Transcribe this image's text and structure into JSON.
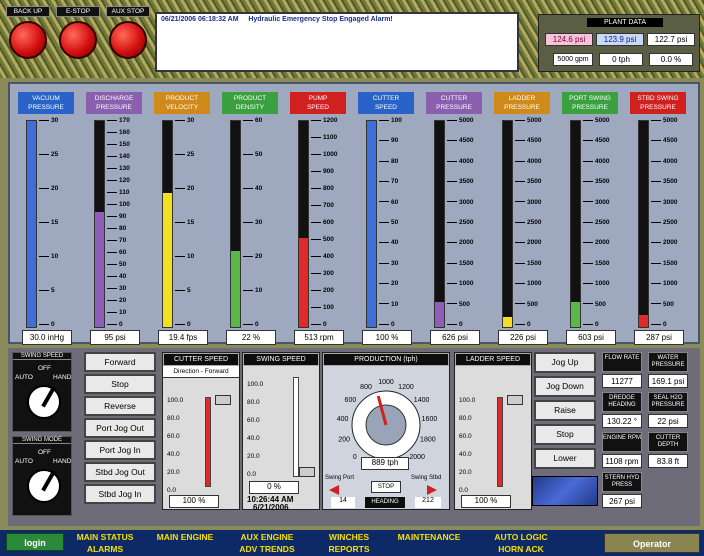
{
  "header": {
    "buttons": [
      "BACK UP",
      "E-STOP",
      "AUX STOP"
    ],
    "alarm_time": "06/21/2006 06:18:32 AM",
    "alarm_text": "Hydraulic Emergency Stop Engaged Alarm!",
    "plant": {
      "title": "PLANT DATA",
      "p1": "124.6 psi",
      "p2": "123.9 psi",
      "p3": "122.7 psi",
      "gpm": "5000 gpm",
      "tph": "0 tph",
      "pct": "0.0 %"
    }
  },
  "gauges": [
    {
      "t1": "VACUUM",
      "t2": "PRESSURE",
      "color": "#2a63c8",
      "fill": "#3e6fd6",
      "frac": 1.0,
      "value": "30.0 inHg",
      "ticks": [
        "30",
        "25",
        "20",
        "15",
        "10",
        "5",
        "0"
      ]
    },
    {
      "t1": "DISCHARGE",
      "t2": "PRESSURE",
      "color": "#8a5fb0",
      "fill": "#8e5fb8",
      "frac": 0.56,
      "value": "95 psi",
      "ticks": [
        "170",
        "160",
        "150",
        "140",
        "130",
        "120",
        "110",
        "100",
        "90",
        "80",
        "70",
        "60",
        "50",
        "40",
        "30",
        "20",
        "10",
        "0"
      ]
    },
    {
      "t1": "PRODUCT",
      "t2": "VELOCITY",
      "color": "#d08a1a",
      "fill": "#f0e020",
      "frac": 0.65,
      "value": "19.4 fps",
      "ticks": [
        "30",
        "25",
        "20",
        "15",
        "10",
        "5",
        "0"
      ]
    },
    {
      "t1": "PRODUCT",
      "t2": "DENSITY",
      "color": "#3aa040",
      "fill": "#5ab848",
      "frac": 0.37,
      "value": "22 %",
      "ticks": [
        "60",
        "50",
        "40",
        "30",
        "20",
        "10",
        "0"
      ]
    },
    {
      "t1": "PUMP",
      "t2": "SPEED",
      "color": "#d02020",
      "fill": "#e02a2a",
      "frac": 0.43,
      "value": "513 rpm",
      "ticks": [
        "1200",
        "1100",
        "1000",
        "900",
        "800",
        "700",
        "600",
        "500",
        "400",
        "300",
        "200",
        "100",
        "0"
      ]
    },
    {
      "t1": "CUTTER",
      "t2": "SPEED",
      "color": "#2a63c8",
      "fill": "#3e6fd6",
      "frac": 1.0,
      "value": "100 %",
      "ticks": [
        "100",
        "90",
        "80",
        "70",
        "60",
        "50",
        "40",
        "30",
        "20",
        "10",
        "0"
      ]
    },
    {
      "t1": "CUTTER",
      "t2": "PRESSURE",
      "color": "#8a5fb0",
      "fill": "#8e5fb8",
      "frac": 0.12,
      "value": "626 psi",
      "ticks": [
        "5000",
        "4500",
        "4000",
        "3500",
        "3000",
        "2500",
        "2000",
        "1500",
        "1000",
        "500",
        "0"
      ]
    },
    {
      "t1": "LADDER",
      "t2": "PRESSURE",
      "color": "#d08a1a",
      "fill": "#f0e020",
      "frac": 0.05,
      "value": "226 psi",
      "ticks": [
        "5000",
        "4500",
        "4000",
        "3500",
        "3000",
        "2500",
        "2000",
        "1500",
        "1000",
        "500",
        "0"
      ]
    },
    {
      "t1": "PORT SWING",
      "t2": "PRESSURE",
      "color": "#3aa040",
      "fill": "#5ab848",
      "frac": 0.12,
      "value": "603 psi",
      "ticks": [
        "5000",
        "4500",
        "4000",
        "3500",
        "3000",
        "2500",
        "2000",
        "1500",
        "1000",
        "500",
        "0"
      ]
    },
    {
      "t1": "STBD SWING",
      "t2": "PRESSURE",
      "color": "#d02020",
      "fill": "#e02a2a",
      "frac": 0.06,
      "value": "287 psi",
      "ticks": [
        "5000",
        "4500",
        "4000",
        "3500",
        "3000",
        "2500",
        "2000",
        "1500",
        "1000",
        "500",
        "0"
      ]
    }
  ],
  "controls": {
    "swing_speed": "SWING SPEED",
    "swing_mode": "SWING MODE",
    "off": "OFF",
    "auto": "AUTO",
    "hand": "HAND",
    "swing_buttons": [
      "Forward",
      "Stop",
      "Reverse",
      "Port Jog Out",
      "Port Jog In",
      "Stbd Jog Out",
      "Stbd Jog In"
    ],
    "cutter_speed": "CUTTER SPEED",
    "direction": "Direction - Forward",
    "cutter_val": "100 %",
    "slider_ticks": [
      "100.0",
      "80.0",
      "60.0",
      "40.0",
      "20.0",
      "0.0"
    ],
    "swing_speed2": "SWING SPEED",
    "swing_val": "0 %",
    "datetime1": "10:26:44 AM",
    "datetime2": "6/21/2006",
    "production": "PRODUCTION (tph)",
    "prod_val": "889 tph",
    "swing_port": "Swing Port",
    "stop": "STOP",
    "swing_stbd": "Swing Stbd",
    "heading_l": "14",
    "heading": "HEADING",
    "heading_r": "212",
    "dial_ticks": [
      "0",
      "200",
      "400",
      "600",
      "800",
      "1000",
      "1200",
      "1400",
      "1600",
      "1800",
      "2000"
    ],
    "dial_value": 889,
    "ladder_speed": "LADDER SPEED",
    "ladder_val": "100 %",
    "ladder_buttons": [
      "Jog Up",
      "Jog Down",
      "Raise",
      "Stop",
      "Lower"
    ]
  },
  "right_info": [
    {
      "l": "FLOW RATE",
      "v": "11277 gpm"
    },
    {
      "l": "WATER PRESSURE",
      "v": "169.1 psi"
    },
    {
      "l": "DREDGE HEADING",
      "v": "130.22 °"
    },
    {
      "l": "SEAL H2O PRESSURE",
      "v": "22 psi"
    },
    {
      "l": "ENGINE RPM",
      "v": "1108 rpm"
    },
    {
      "l": "CUTTER DEPTH",
      "v": "83.8 ft"
    },
    {
      "l": "STERN HYD PRESS",
      "v": "267 psi"
    }
  ],
  "nav": {
    "login": "login",
    "items": [
      "MAIN STATUS",
      "MAIN ENGINE",
      "AUX ENGINE",
      "WINCHES",
      "MAINTENANCE",
      "AUTO LOGIC",
      "ALARMS",
      "ADV TRENDS",
      "REPORTS",
      "HORN ACK"
    ],
    "operator": "Operator"
  }
}
